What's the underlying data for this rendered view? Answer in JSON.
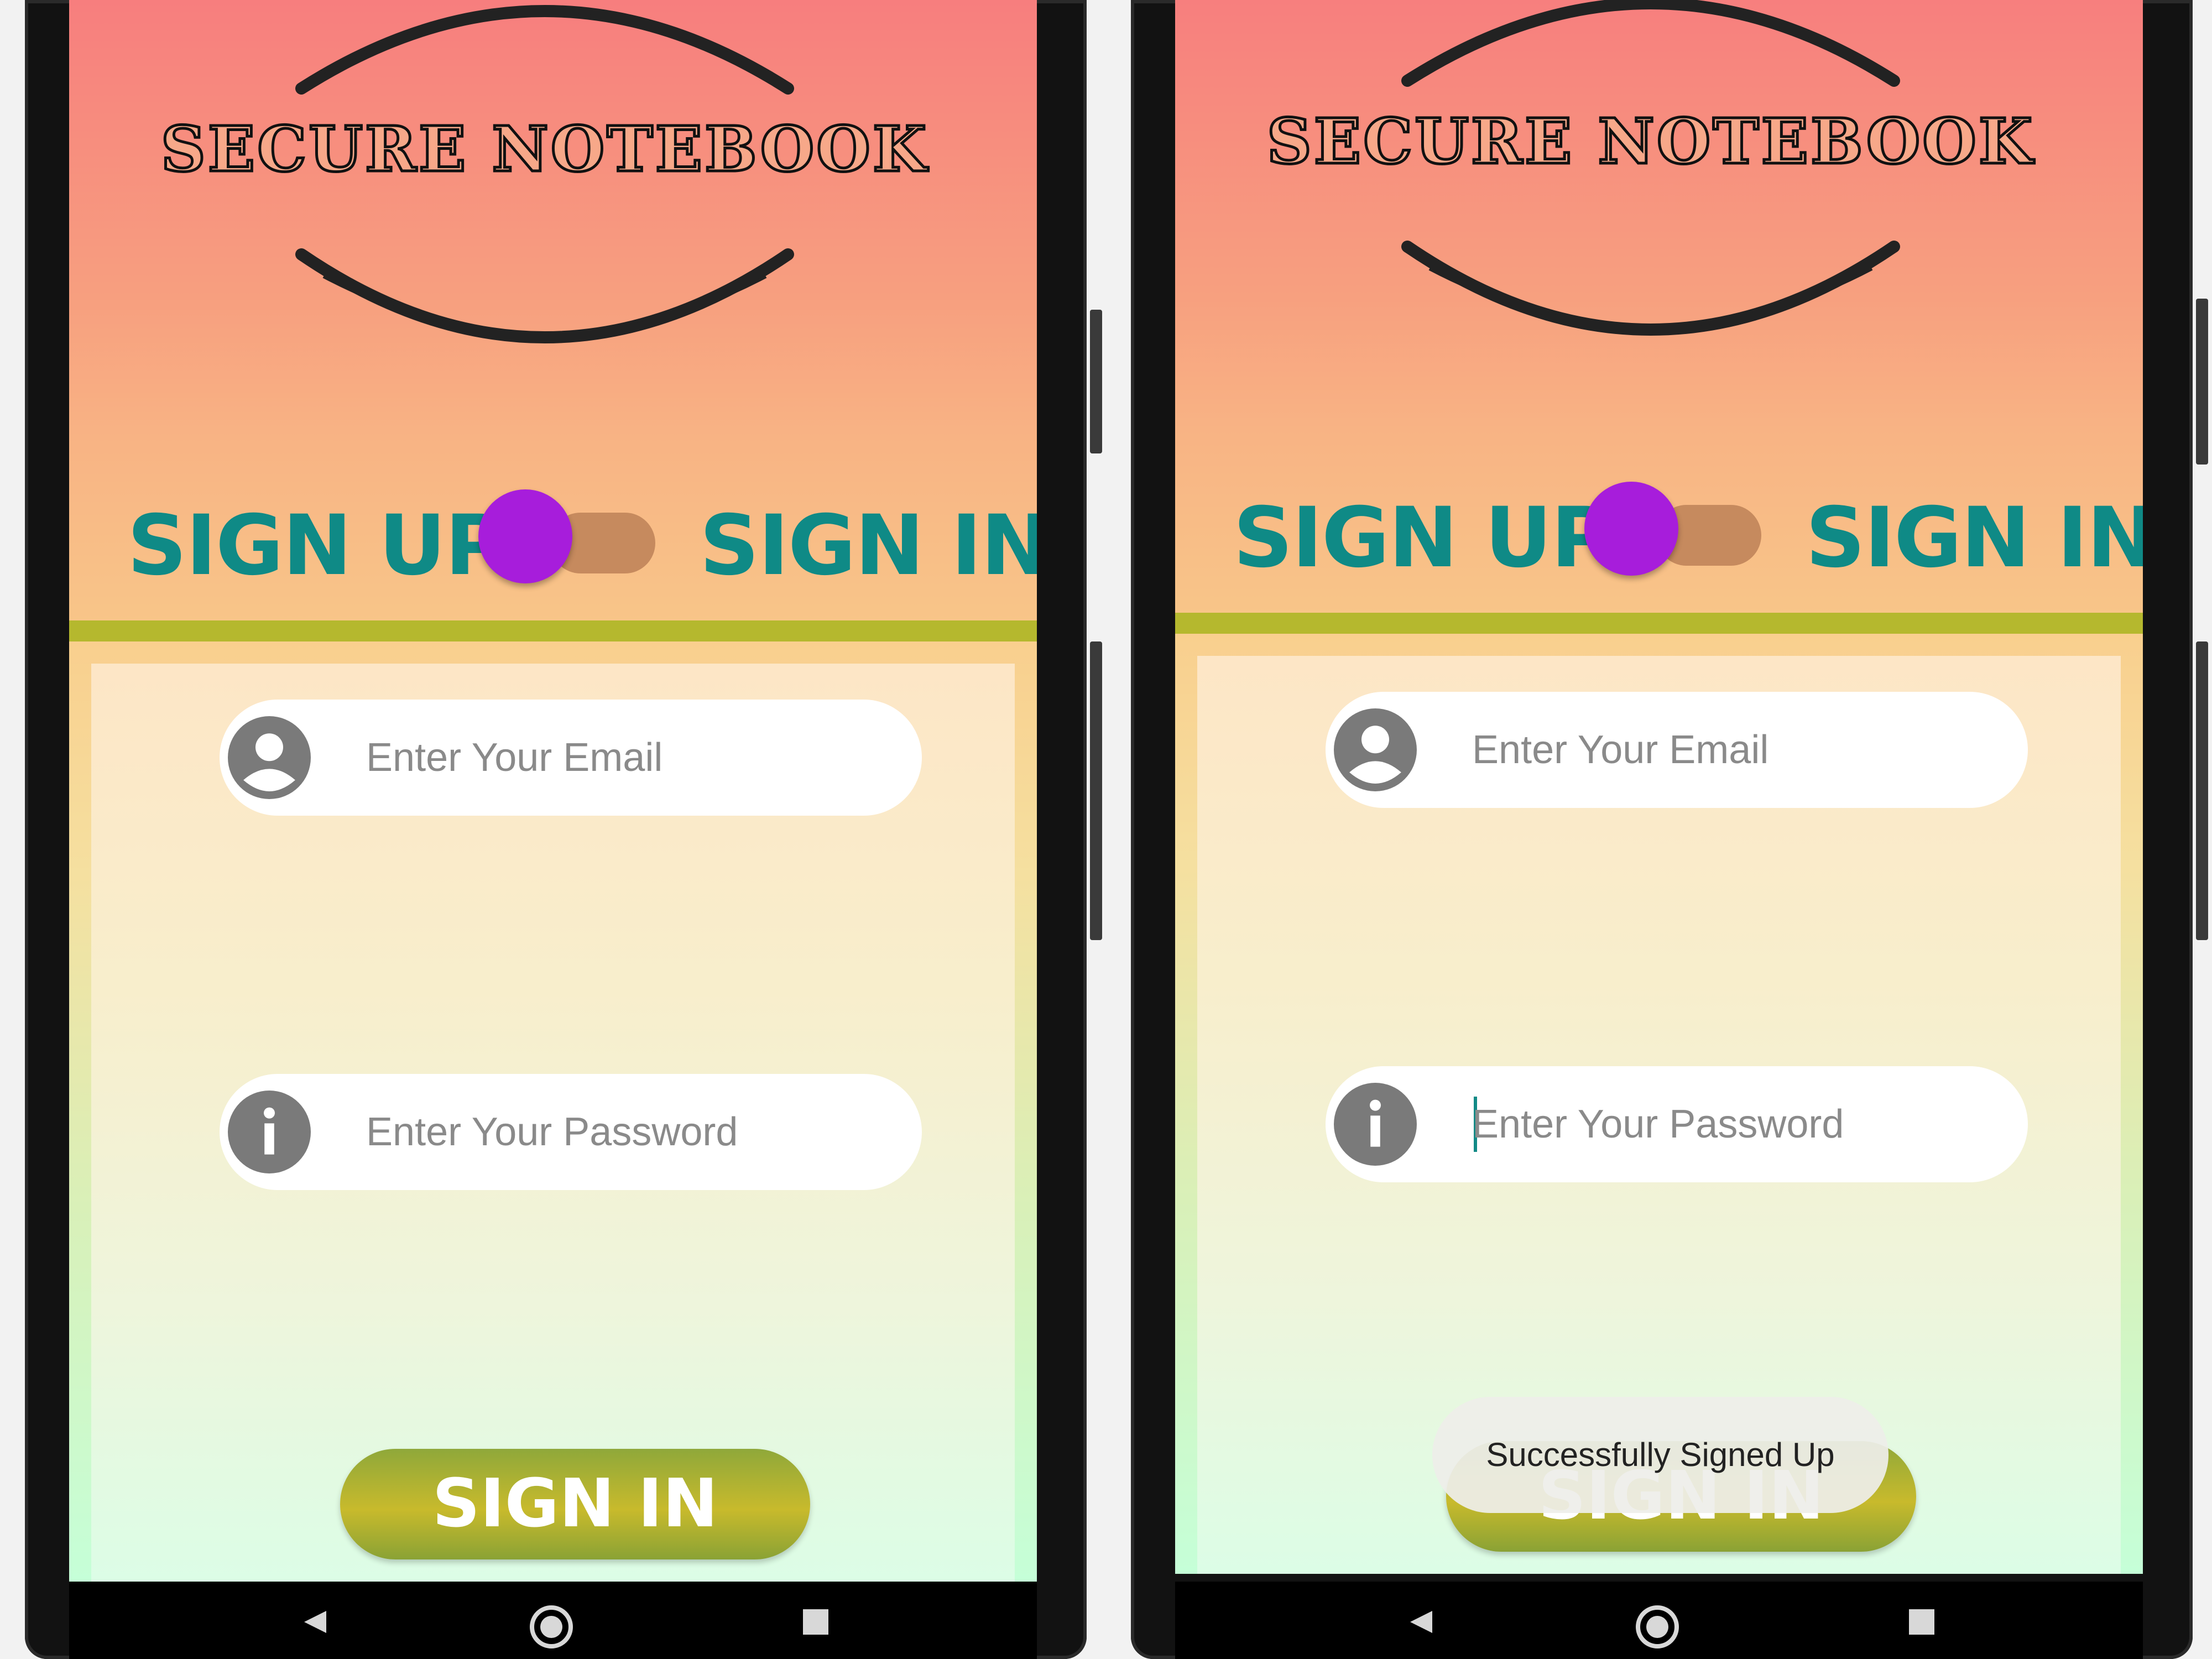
{
  "colors": {
    "accent_teal": "#0f8a86",
    "toggle_thumb": "#a71ddb",
    "stripe": "#b5b82e",
    "header_top": "#f77e7e",
    "button_green": "#b5b82e"
  },
  "screens": [
    {
      "logo_text": "SECURE NOTEBOOK",
      "tabs": {
        "left": "SIGN UP",
        "right": "SIGN IN"
      },
      "email": {
        "placeholder": "Enter Your Email",
        "icon": "account-circle-icon"
      },
      "password": {
        "placeholder": "Enter Your Password",
        "icon": "info-icon"
      },
      "primary_button": "SIGN IN",
      "nav": [
        "back-icon",
        "home-icon",
        "recents-icon"
      ]
    },
    {
      "logo_text": "SECURE NOTEBOOK",
      "tabs": {
        "left": "SIGN UP",
        "right": "SIGN IN"
      },
      "email": {
        "placeholder": "Enter Your Email",
        "icon": "account-circle-icon"
      },
      "password": {
        "placeholder": "Enter Your Password",
        "icon": "info-icon"
      },
      "primary_button": "SIGN IN",
      "toast": "Successfully Signed Up",
      "nav": [
        "back-icon",
        "home-icon",
        "recents-icon"
      ]
    }
  ]
}
